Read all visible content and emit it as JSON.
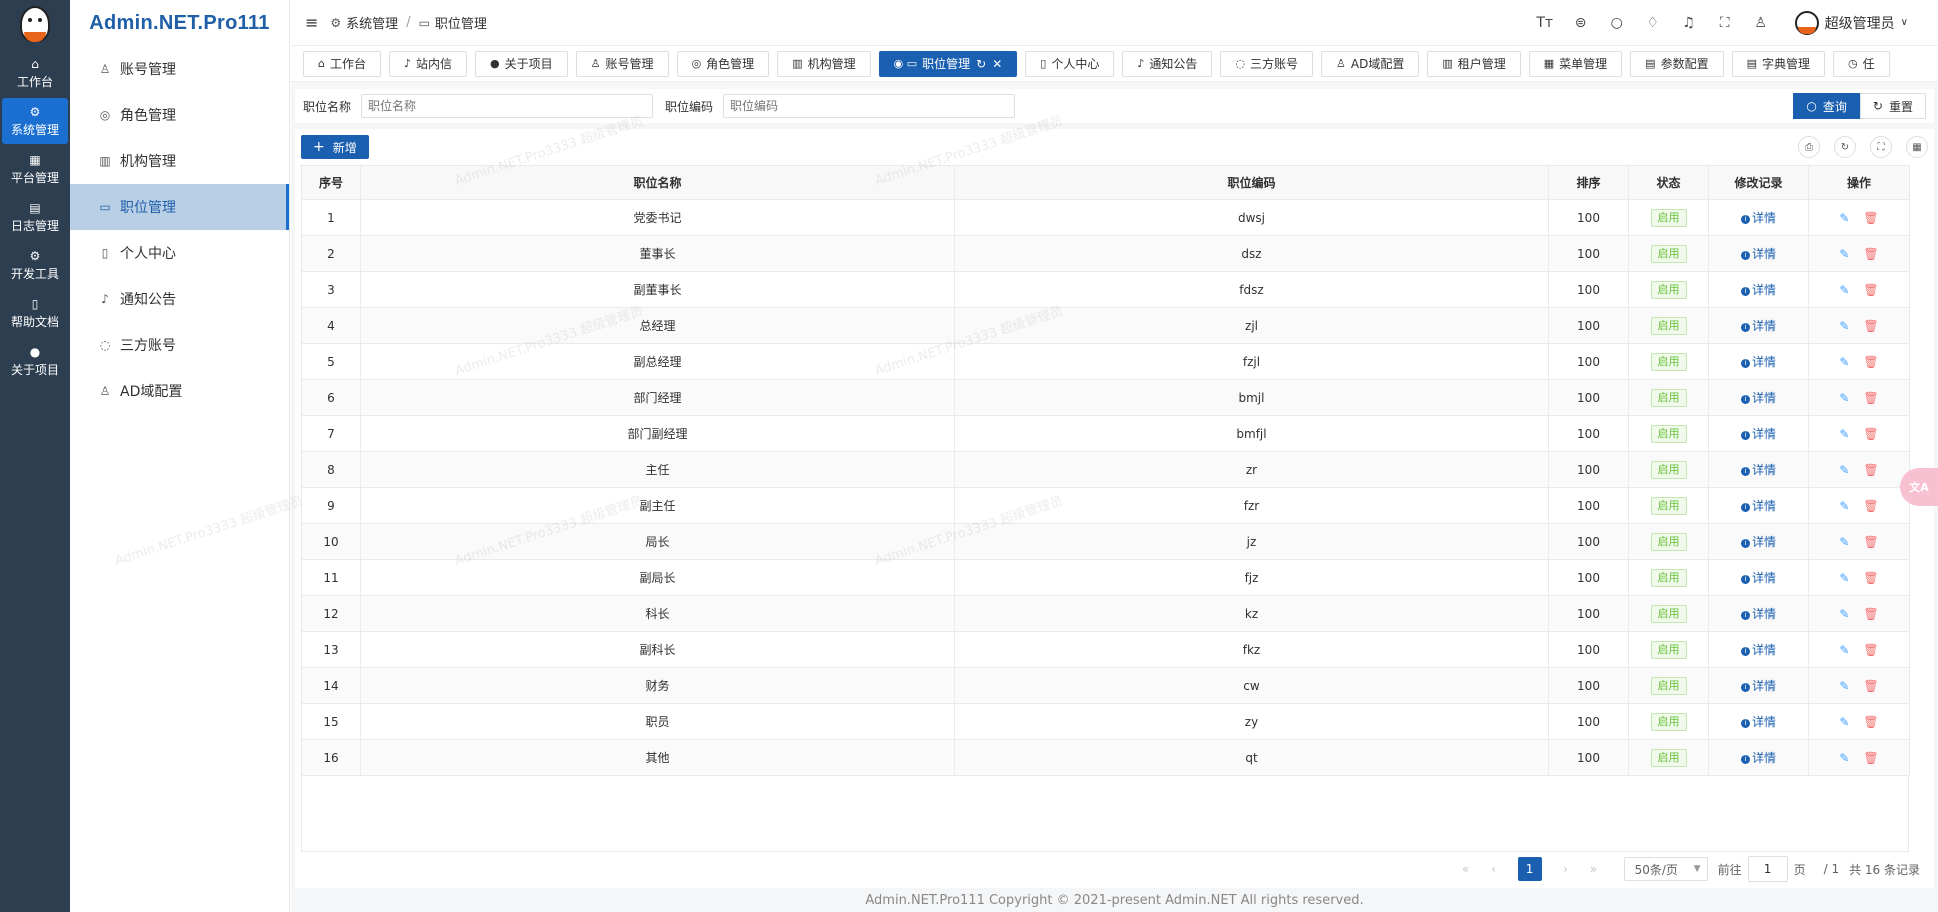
{
  "rail": {
    "items": [
      {
        "label": "工作台",
        "icon": "home-icon",
        "glyph": "⌂"
      },
      {
        "label": "系统管理",
        "icon": "gear-icon",
        "glyph": "⚙"
      },
      {
        "label": "平台管理",
        "icon": "grid-icon",
        "glyph": "▦"
      },
      {
        "label": "日志管理",
        "icon": "log-icon",
        "glyph": "▤"
      },
      {
        "label": "开发工具",
        "icon": "tool-icon",
        "glyph": "⚙"
      },
      {
        "label": "帮助文档",
        "icon": "doc-icon",
        "glyph": "▯"
      },
      {
        "label": "关于项目",
        "icon": "info-icon",
        "glyph": "●"
      }
    ]
  },
  "sidebar": {
    "brand": "Admin.NET.Pro111",
    "items": [
      {
        "label": "账号管理",
        "glyph": "♙"
      },
      {
        "label": "角色管理",
        "glyph": "◎"
      },
      {
        "label": "机构管理",
        "glyph": "▥"
      },
      {
        "label": "职位管理",
        "glyph": "▭"
      },
      {
        "label": "个人中心",
        "glyph": "▯"
      },
      {
        "label": "通知公告",
        "glyph": "♪"
      },
      {
        "label": "三方账号",
        "glyph": "◌"
      },
      {
        "label": "AD域配置",
        "glyph": "♙"
      }
    ]
  },
  "header": {
    "breadcrumb": [
      "系统管理",
      "职位管理"
    ],
    "user_name": "超级管理员"
  },
  "tabs": [
    {
      "label": "工作台",
      "glyph": "⌂"
    },
    {
      "label": "站内信",
      "glyph": "♪"
    },
    {
      "label": "关于项目",
      "glyph": "●"
    },
    {
      "label": "账号管理",
      "glyph": "♙"
    },
    {
      "label": "角色管理",
      "glyph": "◎"
    },
    {
      "label": "机构管理",
      "glyph": "▥"
    },
    {
      "label": "职位管理",
      "glyph": "▭"
    },
    {
      "label": "个人中心",
      "glyph": "▯"
    },
    {
      "label": "通知公告",
      "glyph": "♪"
    },
    {
      "label": "三方账号",
      "glyph": "◌"
    },
    {
      "label": "AD域配置",
      "glyph": "♙"
    },
    {
      "label": "租户管理",
      "glyph": "▥"
    },
    {
      "label": "菜单管理",
      "glyph": "▦"
    },
    {
      "label": "参数配置",
      "glyph": "▤"
    },
    {
      "label": "字典管理",
      "glyph": "▤"
    },
    {
      "label": "任",
      "glyph": "◷"
    }
  ],
  "search": {
    "name_label": "职位名称",
    "name_placeholder": "职位名称",
    "code_label": "职位编码",
    "code_placeholder": "职位编码",
    "query_label": "查询",
    "reset_label": "重置"
  },
  "toolbar": {
    "add_label": "新增"
  },
  "table": {
    "columns": [
      "序号",
      "职位名称",
      "职位编码",
      "排序",
      "状态",
      "修改记录",
      "操作"
    ],
    "status_label": "启用",
    "detail_label": "详情",
    "rows": [
      {
        "idx": "1",
        "name": "党委书记",
        "code": "dwsj",
        "sort": "100"
      },
      {
        "idx": "2",
        "name": "董事长",
        "code": "dsz",
        "sort": "100"
      },
      {
        "idx": "3",
        "name": "副董事长",
        "code": "fdsz",
        "sort": "100"
      },
      {
        "idx": "4",
        "name": "总经理",
        "code": "zjl",
        "sort": "100"
      },
      {
        "idx": "5",
        "name": "副总经理",
        "code": "fzjl",
        "sort": "100"
      },
      {
        "idx": "6",
        "name": "部门经理",
        "code": "bmjl",
        "sort": "100"
      },
      {
        "idx": "7",
        "name": "部门副经理",
        "code": "bmfjl",
        "sort": "100"
      },
      {
        "idx": "8",
        "name": "主任",
        "code": "zr",
        "sort": "100"
      },
      {
        "idx": "9",
        "name": "副主任",
        "code": "fzr",
        "sort": "100"
      },
      {
        "idx": "10",
        "name": "局长",
        "code": "jz",
        "sort": "100"
      },
      {
        "idx": "11",
        "name": "副局长",
        "code": "fjz",
        "sort": "100"
      },
      {
        "idx": "12",
        "name": "科长",
        "code": "kz",
        "sort": "100"
      },
      {
        "idx": "13",
        "name": "副科长",
        "code": "fkz",
        "sort": "100"
      },
      {
        "idx": "14",
        "name": "财务",
        "code": "cw",
        "sort": "100"
      },
      {
        "idx": "15",
        "name": "职员",
        "code": "zy",
        "sort": "100"
      },
      {
        "idx": "16",
        "name": "其他",
        "code": "qt",
        "sort": "100"
      }
    ]
  },
  "pager": {
    "current_page": "1",
    "page_size": "50条/页",
    "goto_label": "前往",
    "goto_value": "1",
    "page_unit": "页",
    "total_pages": "/ 1",
    "total_records": "共 16 条记录"
  },
  "footer": "Admin.NET.Pro111 Copyright © 2021-present Admin.NET All rights reserved.",
  "watermark": "Admin.NET.Pro3333 超级管理员",
  "colors": {
    "primary": "#1a5fb0",
    "rail_bg": "#2c3e50",
    "success": "#67c23a",
    "danger": "#f56c6c"
  }
}
